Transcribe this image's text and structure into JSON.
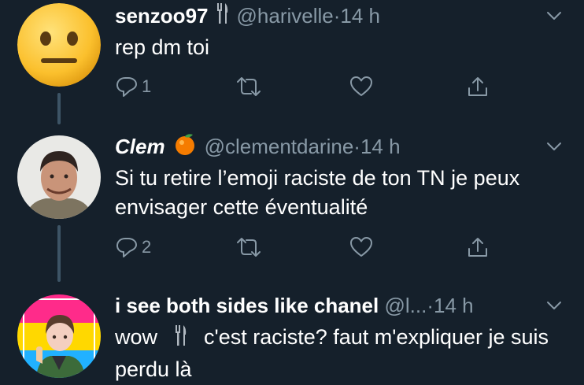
{
  "colors": {
    "background": "#15202b",
    "text": "#ffffff",
    "secondary": "#8899a6",
    "thread_line": "#3d5466"
  },
  "tweets": [
    {
      "name": "senzoo97",
      "name_emoji": "fork-and-knife-icon",
      "handle": "@harivelle",
      "sep": " · ",
      "time": "14 h",
      "text": "rep dm toi",
      "reply_count": "1",
      "avatar": "neutral-face-emoji-avatar"
    },
    {
      "name": "Clem",
      "name_emoji": "tangerine-icon",
      "handle": "@clementdarine",
      "sep": " · ",
      "time": "14 h",
      "text": "Si tu retire l’emoji raciste de ton TN je peux envisager cette éventualité",
      "reply_count": "2",
      "avatar": "man-photo-avatar"
    },
    {
      "name": "i see both sides like chanel",
      "handle": "@l...",
      "sep": " · ",
      "time": "14 h",
      "text_before": "wow",
      "text_emoji": "fork-and-knife-icon",
      "text_after": "c'est raciste? faut m'expliquer je suis perdu là",
      "avatar": "illustrated-character-avatar"
    }
  ]
}
